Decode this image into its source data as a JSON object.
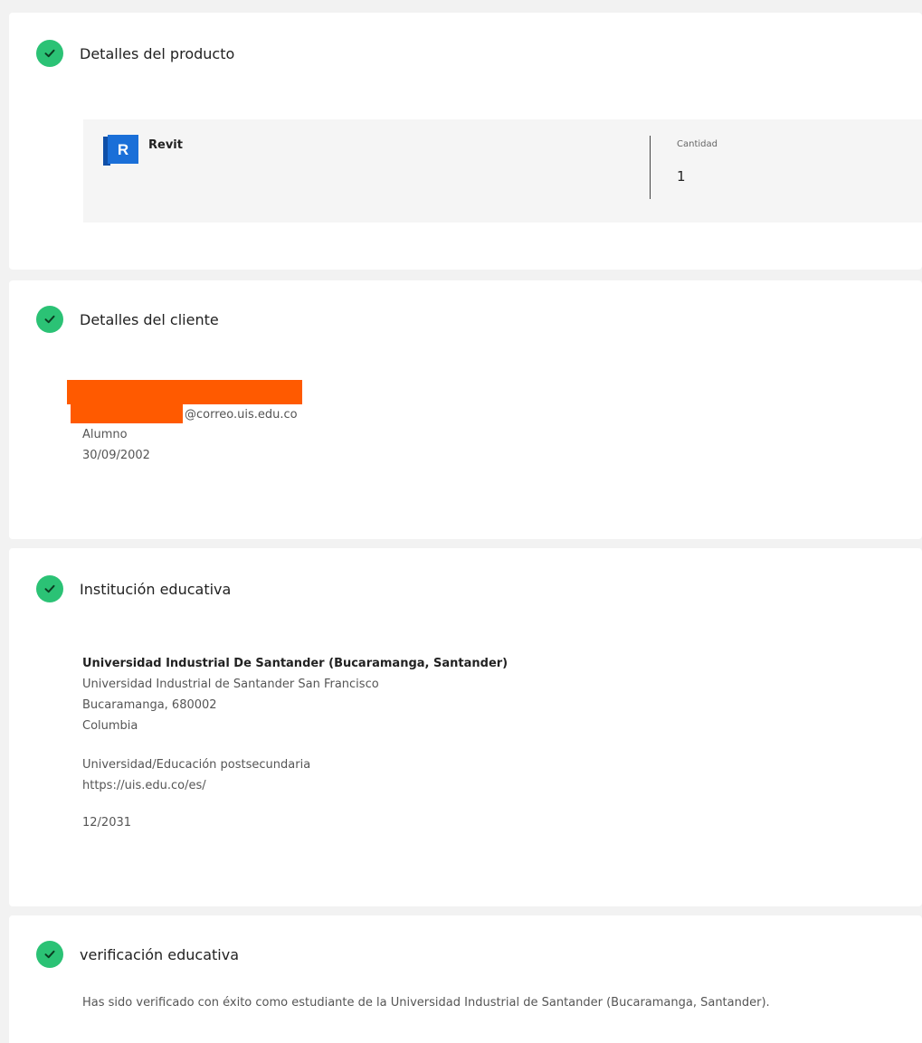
{
  "product_details": {
    "title": "Detalles del producto",
    "product_name": "Revit",
    "logo_letter": "R",
    "quantity_label": "Cantidad",
    "quantity_value": "1"
  },
  "client_details": {
    "title": "Detalles del cliente",
    "email_suffix": "@correo.uis.edu.co",
    "role": "Alumno",
    "birth_date": "30/09/2002"
  },
  "institution": {
    "title": "Institución educativa",
    "name": "Universidad Industrial De Santander (Bucaramanga, Santander)",
    "campus": "Universidad Industrial de Santander San Francisco",
    "city_zip": "Bucaramanga, 680002",
    "country": "Columbia",
    "type": "Universidad/Educación postsecundaria",
    "website": "https://uis.edu.co/es/",
    "end_date": "12/2031"
  },
  "verification": {
    "title": "verificación educativa",
    "message": "Has sido verificado con éxito como estudiante de la Universidad Industrial de Santander (Bucaramanga, Santander)."
  },
  "colors": {
    "check_green": "#2bc275",
    "redaction": "#ff5a00",
    "revit_blue": "#1a6fd8"
  }
}
